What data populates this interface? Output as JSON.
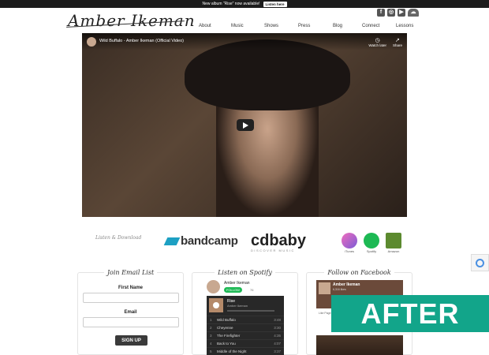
{
  "announcement": {
    "text": "New album \"Rise\" now available!",
    "button": "Listen here"
  },
  "logo": "Amber Ikeman",
  "social": [
    "facebook-icon",
    "instagram-icon",
    "youtube-icon",
    "soundcloud-icon"
  ],
  "nav": [
    "About",
    "Music",
    "Shows",
    "Press",
    "Blog",
    "Connect",
    "Lessons"
  ],
  "video": {
    "title": "Wild Buffalo - Amber Ikeman (Official Video)",
    "watch_later": "Watch later",
    "share": "Share"
  },
  "listen_download": "Listen & Download",
  "bandcamp": "bandcamp",
  "cdbaby": {
    "name": "cdbaby",
    "tagline": "DISCOVER MUSIC"
  },
  "stores": [
    {
      "label": "iTunes",
      "color": "#e05fa8"
    },
    {
      "label": "Spotify",
      "color": "#1db954"
    },
    {
      "label": "Amazon",
      "color": "#5c8a2f"
    }
  ],
  "email_list": {
    "title": "Join Email List",
    "first_name": "First Name",
    "email": "Email",
    "submit": "SIGN UP"
  },
  "spotify": {
    "title": "Listen on Spotify",
    "artist": "Amber Ikeman",
    "follow": "FOLLOW",
    "followers": "76",
    "album": "Rise",
    "album_artist": "Amber Ikeman",
    "tracks": [
      {
        "n": "1",
        "title": "Wild Buffalo",
        "dur": "3:48"
      },
      {
        "n": "2",
        "title": "Cheyenne",
        "dur": "3:30"
      },
      {
        "n": "3",
        "title": "The Firefighter",
        "dur": "4:35"
      },
      {
        "n": "4",
        "title": "Back to You",
        "dur": "4:07"
      },
      {
        "n": "5",
        "title": "Middle of the Night",
        "dur": "3:37"
      }
    ]
  },
  "facebook": {
    "title": "Follow on Facebook",
    "name": "Amber Ikeman",
    "sub": "6,316 likes",
    "like": "Like Page"
  },
  "badge": "AFTER"
}
